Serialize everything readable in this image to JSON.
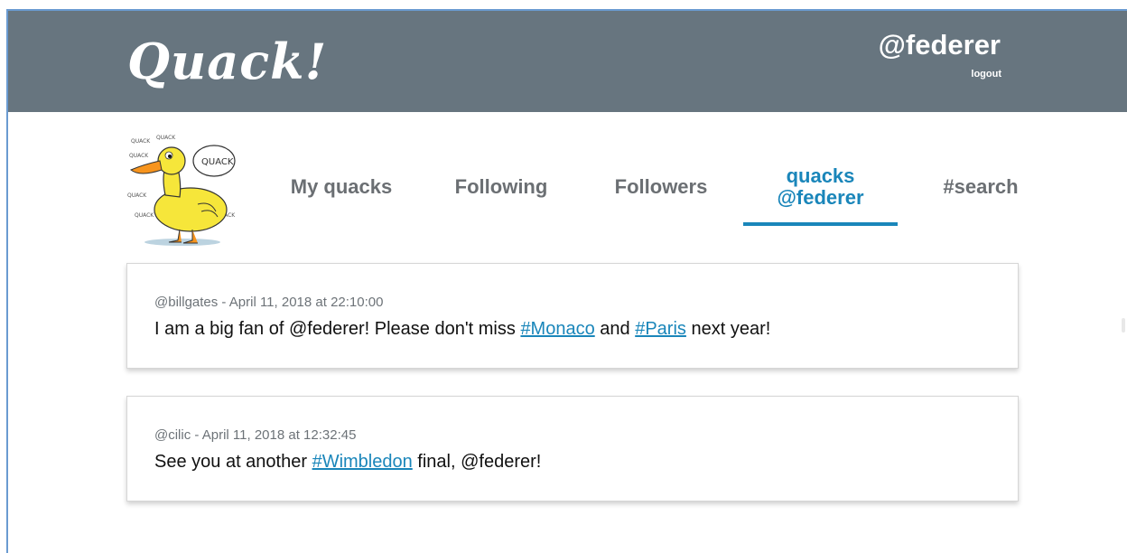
{
  "app": {
    "title": "Quack!"
  },
  "header": {
    "user": "@federer",
    "logout": "logout"
  },
  "nav": {
    "my_quacks": "My quacks",
    "following": "Following",
    "followers": "Followers",
    "active_line1": "quacks",
    "active_line2": "@federer",
    "search": "#search"
  },
  "logo": {
    "bubble_text": "QUACK",
    "bg_words": [
      "QUACK",
      "QUACK",
      "QUACK",
      "QUACK",
      "QUACK",
      "QUACK"
    ]
  },
  "quacks": [
    {
      "author": "@billgates",
      "sep": " - ",
      "date": "April 11, 2018 at 22:10:00",
      "parts": [
        "I am a big fan of @federer! Please don't miss ",
        "#Monaco",
        " and ",
        "#Paris",
        " next year!"
      ]
    },
    {
      "author": "@cilic",
      "sep": " - ",
      "date": "April 11, 2018 at 12:32:45",
      "parts": [
        "See you at another ",
        "#Wimbledon",
        " final, @federer!"
      ]
    }
  ],
  "colors": {
    "header_bg": "#67757f",
    "accent": "#1a86ba",
    "nav_text": "#6b6f73"
  }
}
